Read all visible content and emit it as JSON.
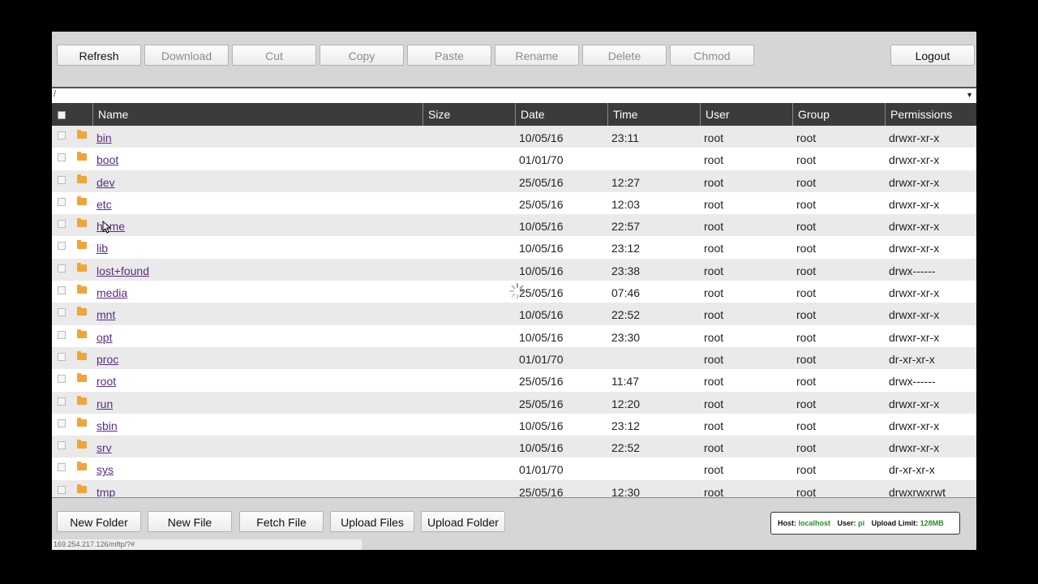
{
  "toolbar": {
    "refresh": "Refresh",
    "download": "Download",
    "cut": "Cut",
    "copy": "Copy",
    "paste": "Paste",
    "rename": "Rename",
    "delete": "Delete",
    "chmod": "Chmod",
    "logout": "Logout"
  },
  "path": "/",
  "columns": [
    "Name",
    "Size",
    "Date",
    "Time",
    "User",
    "Group",
    "Permissions"
  ],
  "rows": [
    {
      "name": "bin",
      "size": "",
      "date": "10/05/16",
      "time": "23:11",
      "user": "root",
      "group": "root",
      "perms": "drwxr-xr-x"
    },
    {
      "name": "boot",
      "size": "",
      "date": "01/01/70",
      "time": "",
      "user": "root",
      "group": "root",
      "perms": "drwxr-xr-x"
    },
    {
      "name": "dev",
      "size": "",
      "date": "25/05/16",
      "time": "12:27",
      "user": "root",
      "group": "root",
      "perms": "drwxr-xr-x"
    },
    {
      "name": "etc",
      "size": "",
      "date": "25/05/16",
      "time": "12:03",
      "user": "root",
      "group": "root",
      "perms": "drwxr-xr-x"
    },
    {
      "name": "home",
      "size": "",
      "date": "10/05/16",
      "time": "22:57",
      "user": "root",
      "group": "root",
      "perms": "drwxr-xr-x"
    },
    {
      "name": "lib",
      "size": "",
      "date": "10/05/16",
      "time": "23:12",
      "user": "root",
      "group": "root",
      "perms": "drwxr-xr-x"
    },
    {
      "name": "lost+found",
      "size": "",
      "date": "10/05/16",
      "time": "23:38",
      "user": "root",
      "group": "root",
      "perms": "drwx------"
    },
    {
      "name": "media",
      "size": "",
      "date": "25/05/16",
      "time": "07:46",
      "user": "root",
      "group": "root",
      "perms": "drwxr-xr-x"
    },
    {
      "name": "mnt",
      "size": "",
      "date": "10/05/16",
      "time": "22:52",
      "user": "root",
      "group": "root",
      "perms": "drwxr-xr-x"
    },
    {
      "name": "opt",
      "size": "",
      "date": "10/05/16",
      "time": "23:30",
      "user": "root",
      "group": "root",
      "perms": "drwxr-xr-x"
    },
    {
      "name": "proc",
      "size": "",
      "date": "01/01/70",
      "time": "",
      "user": "root",
      "group": "root",
      "perms": "dr-xr-xr-x"
    },
    {
      "name": "root",
      "size": "",
      "date": "25/05/16",
      "time": "11:47",
      "user": "root",
      "group": "root",
      "perms": "drwx------"
    },
    {
      "name": "run",
      "size": "",
      "date": "25/05/16",
      "time": "12:20",
      "user": "root",
      "group": "root",
      "perms": "drwxr-xr-x"
    },
    {
      "name": "sbin",
      "size": "",
      "date": "10/05/16",
      "time": "23:12",
      "user": "root",
      "group": "root",
      "perms": "drwxr-xr-x"
    },
    {
      "name": "srv",
      "size": "",
      "date": "10/05/16",
      "time": "22:52",
      "user": "root",
      "group": "root",
      "perms": "drwxr-xr-x"
    },
    {
      "name": "sys",
      "size": "",
      "date": "01/01/70",
      "time": "",
      "user": "root",
      "group": "root",
      "perms": "dr-xr-xr-x"
    },
    {
      "name": "tmp",
      "size": "",
      "date": "25/05/16",
      "time": "12:30",
      "user": "root",
      "group": "root",
      "perms": "drwxrwxrwt"
    }
  ],
  "bottom": {
    "new_folder": "New Folder",
    "new_file": "New File",
    "fetch_file": "Fetch File",
    "upload_files": "Upload Files",
    "upload_folder": "Upload Folder"
  },
  "status": {
    "host_label": "Host:",
    "host": "localhost",
    "user_label": "User:",
    "user": "pi",
    "limit_label": "Upload Limit:",
    "limit": "128MB"
  },
  "url": "169.254.217.126/mftp/?#",
  "colors": {
    "status_value": "#2d8a2d",
    "link": "#5b2b87",
    "header_bg": "#3b3b3b",
    "folder": "#f0a53a"
  }
}
